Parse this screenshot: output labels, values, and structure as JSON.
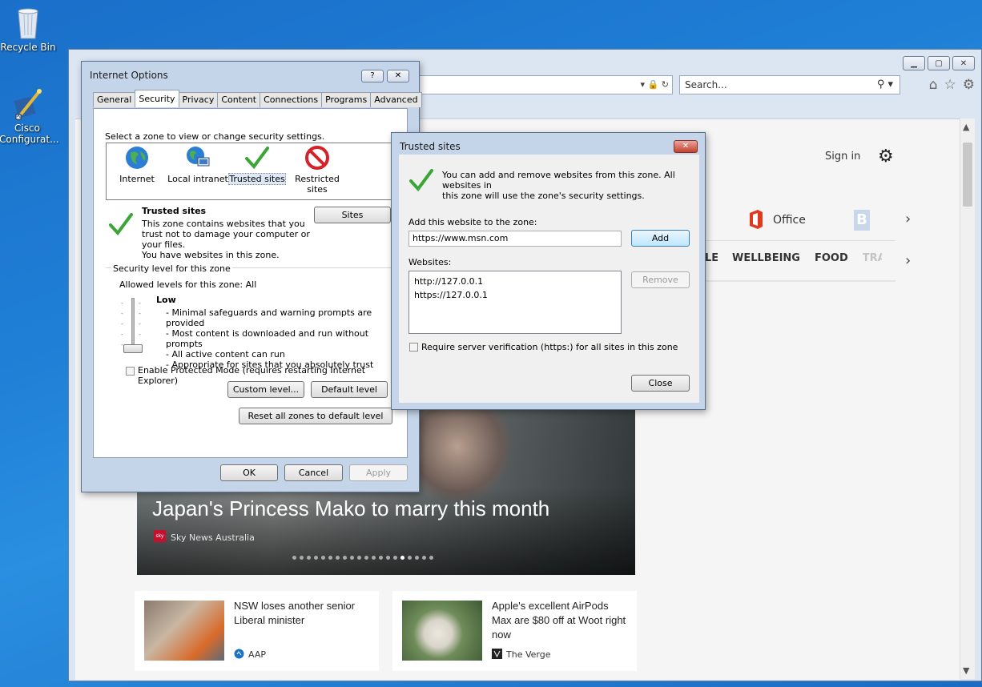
{
  "desktop": {
    "icons": [
      {
        "label": "Recycle Bin"
      },
      {
        "label": "Cisco Configurat..."
      }
    ]
  },
  "ie": {
    "search_placeholder": "Search...",
    "msn": {
      "sign_in": "Sign in",
      "office_label": "Office",
      "nav_categories": [
        "LE",
        "WELLBEING",
        "FOOD",
        "TRA"
      ],
      "hero": {
        "title": "Japan's Princess Mako to marry this month",
        "source": "Sky News Australia",
        "dot_count": 20,
        "active_dot": 15
      },
      "cards": [
        {
          "title": "NSW loses another senior Liberal minister",
          "source": "AAP"
        },
        {
          "title": "Apple's excellent AirPods Max are $80 off at Woot right now",
          "source": "The Verge"
        }
      ]
    }
  },
  "internet_options": {
    "title": "Internet Options",
    "tabs": [
      "General",
      "Security",
      "Privacy",
      "Content",
      "Connections",
      "Programs",
      "Advanced"
    ],
    "active_tab": "Security",
    "select_zone_label": "Select a zone to view or change security settings.",
    "zones": [
      "Internet",
      "Local intranet",
      "Trusted sites",
      "Restricted sites"
    ],
    "selected_zone": "Trusted sites",
    "zone_heading": "Trusted sites",
    "zone_description": [
      "This zone contains websites that you",
      "trust not to damage your computer or",
      "your files.",
      "You have websites in this zone."
    ],
    "sites_button": "Sites",
    "security_level_group": "Security level for this zone",
    "allowed_levels": "Allowed levels for this zone: All",
    "level_name": "Low",
    "level_points": [
      "- Minimal safeguards and warning prompts are provided",
      "- Most content is downloaded and run without prompts",
      "- All active content can run",
      "- Appropriate for sites that you absolutely trust"
    ],
    "protected_mode_label": "Enable Protected Mode (requires restarting Internet Explorer)",
    "protected_mode_checked": false,
    "custom_level_button": "Custom level...",
    "default_level_button": "Default level",
    "reset_all_button": "Reset all zones to default level",
    "ok_button": "OK",
    "cancel_button": "Cancel",
    "apply_button": "Apply"
  },
  "trusted_sites": {
    "title": "Trusted sites",
    "info_text": [
      "You can add and remove websites from this zone. All websites in",
      "this zone will use the zone's security settings."
    ],
    "add_label": "Add this website to the zone:",
    "add_value": "https://www.msn.com",
    "add_button": "Add",
    "websites_label": "Websites:",
    "websites": [
      "http://127.0.0.1",
      "https://127.0.0.1"
    ],
    "remove_button": "Remove",
    "require_https_label": "Require server verification (https:) for all sites in this zone",
    "require_https_checked": false,
    "close_button": "Close"
  },
  "colors": {
    "desktop": "#1f7fd6",
    "dialog_frame": "#c5d5e9",
    "check_green": "#3aa635"
  }
}
